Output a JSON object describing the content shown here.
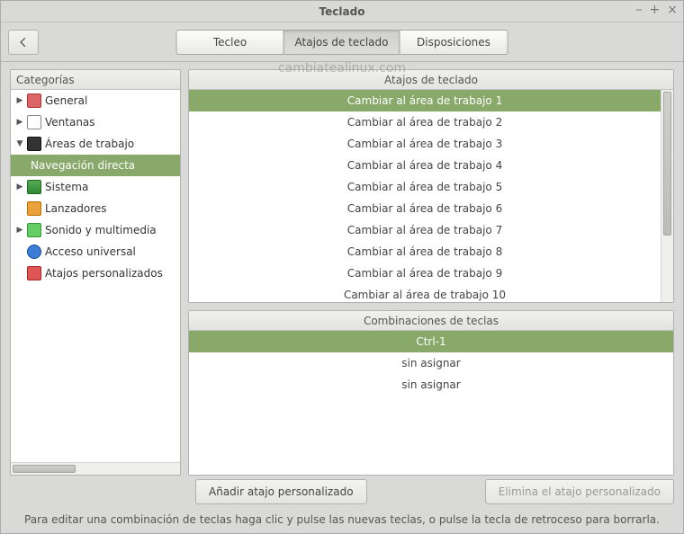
{
  "window": {
    "title": "Teclado",
    "watermark": "cambiatealinux.com"
  },
  "tabs": {
    "typing": "Tecleo",
    "shortcuts": "Atajos de teclado",
    "layouts": "Disposiciones"
  },
  "sidebar": {
    "header": "Categorías",
    "items": [
      {
        "label": "General"
      },
      {
        "label": "Ventanas"
      },
      {
        "label": "Áreas de trabajo"
      },
      {
        "label": "Navegación directa"
      },
      {
        "label": "Sistema"
      },
      {
        "label": "Lanzadores"
      },
      {
        "label": "Sonido y multimedia"
      },
      {
        "label": "Acceso universal"
      },
      {
        "label": "Atajos personalizados"
      }
    ]
  },
  "shortcuts": {
    "header": "Atajos de teclado",
    "rows": [
      "Cambiar al área de trabajo 1",
      "Cambiar al área de trabajo 2",
      "Cambiar al área de trabajo 3",
      "Cambiar al área de trabajo 4",
      "Cambiar al área de trabajo 5",
      "Cambiar al área de trabajo 6",
      "Cambiar al área de trabajo 7",
      "Cambiar al área de trabajo 8",
      "Cambiar al área de trabajo 9",
      "Cambiar al área de trabajo 10"
    ]
  },
  "bindings": {
    "header": "Combinaciones de teclas",
    "rows": [
      "Ctrl-1",
      "sin asignar",
      "sin asignar"
    ]
  },
  "buttons": {
    "add": "Añadir atajo personalizado",
    "remove": "Elimina el atajo personalizado"
  },
  "hint": "Para editar una combinación de teclas haga clic y pulse las nuevas teclas, o pulse la tecla de retroceso para borrarla."
}
